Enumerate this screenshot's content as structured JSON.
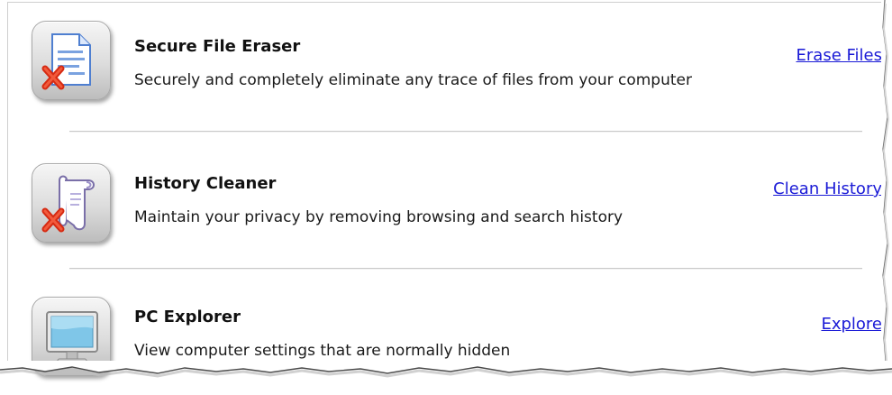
{
  "items": [
    {
      "title": "Secure File Eraser",
      "description": "Securely and completely eliminate any trace of files from your computer",
      "action": "Erase Files",
      "icon": "file-eraser-icon"
    },
    {
      "title": "History Cleaner",
      "description": "Maintain your privacy by removing browsing and search history",
      "action": "Clean History",
      "icon": "history-scroll-icon"
    },
    {
      "title": "PC Explorer",
      "description": "View computer settings that are normally hidden",
      "action": "Explore",
      "icon": "monitor-icon"
    }
  ],
  "colors": {
    "link": "#1a1ad6",
    "title": "#111111",
    "divider": "#c9c9c9",
    "icon_tile": "#d6d6d6",
    "red_x": "#d62a12",
    "document_blue": "#4f7fd0",
    "monitor_screen": "#7fc6e8"
  }
}
